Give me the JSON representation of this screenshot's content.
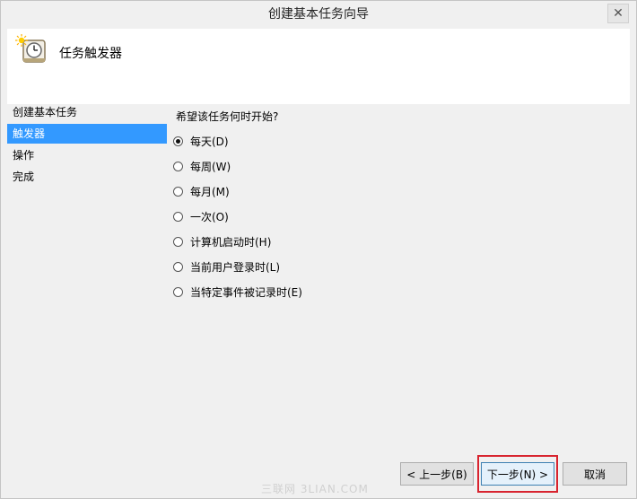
{
  "window": {
    "title": "创建基本任务向导",
    "close_glyph": "✕"
  },
  "header": {
    "title": "任务触发器",
    "icon": "clock-icon"
  },
  "sidebar": {
    "items": [
      {
        "label": "创建基本任务",
        "selected": false
      },
      {
        "label": "触发器",
        "selected": true
      },
      {
        "label": "操作",
        "selected": false
      },
      {
        "label": "完成",
        "selected": false
      }
    ]
  },
  "content": {
    "question": "希望该任务何时开始?",
    "options": [
      {
        "label": "每天(D)",
        "checked": true
      },
      {
        "label": "每周(W)",
        "checked": false
      },
      {
        "label": "每月(M)",
        "checked": false
      },
      {
        "label": "一次(O)",
        "checked": false
      },
      {
        "label": "计算机启动时(H)",
        "checked": false
      },
      {
        "label": "当前用户登录时(L)",
        "checked": false
      },
      {
        "label": "当特定事件被记录时(E)",
        "checked": false
      }
    ]
  },
  "buttons": {
    "back": "< 上一步(B)",
    "next": "下一步(N) >",
    "cancel": "取消"
  },
  "watermark": "三联网 3LIAN.COM",
  "colors": {
    "selection": "#3399ff",
    "highlight_border": "#d8242f"
  }
}
